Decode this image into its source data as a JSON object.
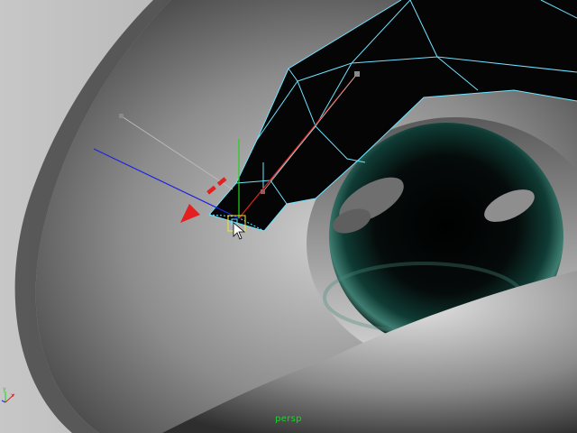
{
  "viewport": {
    "camera_name": "persp"
  },
  "colors": {
    "wireframe_highlight": "#6fe3ff",
    "axis_x": "#e0201c",
    "axis_y": "#21d11a",
    "axis_z": "#1c23e0",
    "drag_arrow": "#e31f1f",
    "selected_vertex": "#f0e62a",
    "camera_label": "#1fd12f",
    "eye_iris": "#0f3b34"
  },
  "icons": {
    "axis_gizmo": "view-axis-icon",
    "cursor": "arrow-cursor-icon",
    "move_arrow": "drag-direction-arrow-icon"
  }
}
